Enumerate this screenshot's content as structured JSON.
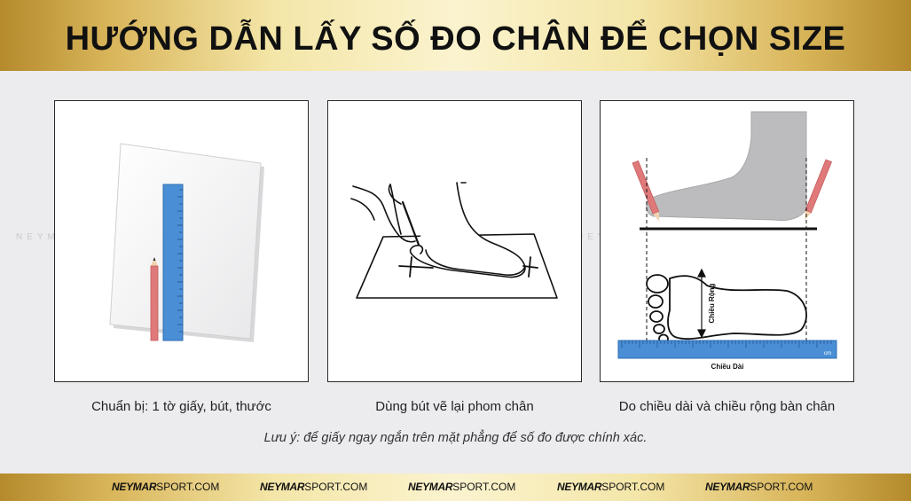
{
  "header": {
    "title": "HƯỚNG DẪN LẤY SỐ ĐO CHÂN ĐỂ CHỌN SIZE"
  },
  "steps": [
    {
      "caption": "Chuẩn bị: 1 tờ giấy, bút, thước"
    },
    {
      "caption": "Dùng bút vẽ lại phom chân"
    },
    {
      "caption": "Do chiều dài và chiều rộng bàn chân"
    }
  ],
  "diagram_labels": {
    "width": "Chiều Rộng",
    "length": "Chiều Dài",
    "unit": "cm"
  },
  "note": "Lưu ý: để giấy ngay ngắn trên mặt phẳng để số đo được chính xác.",
  "watermark": "NEYMARSPORT",
  "footer": {
    "brand_bold": "NEYMAR",
    "brand_rest": "SPORT.COM"
  },
  "colors": {
    "gold_light": "#fbf3cf",
    "gold_dark": "#b48a2c",
    "ruler_blue": "#4a8fd6",
    "pencil_red": "#e07a7a"
  },
  "icons": [
    "paper-icon",
    "ruler-icon",
    "pencil-icon",
    "foot-tracing-icon",
    "foot-side-icon",
    "footprint-icon"
  ]
}
